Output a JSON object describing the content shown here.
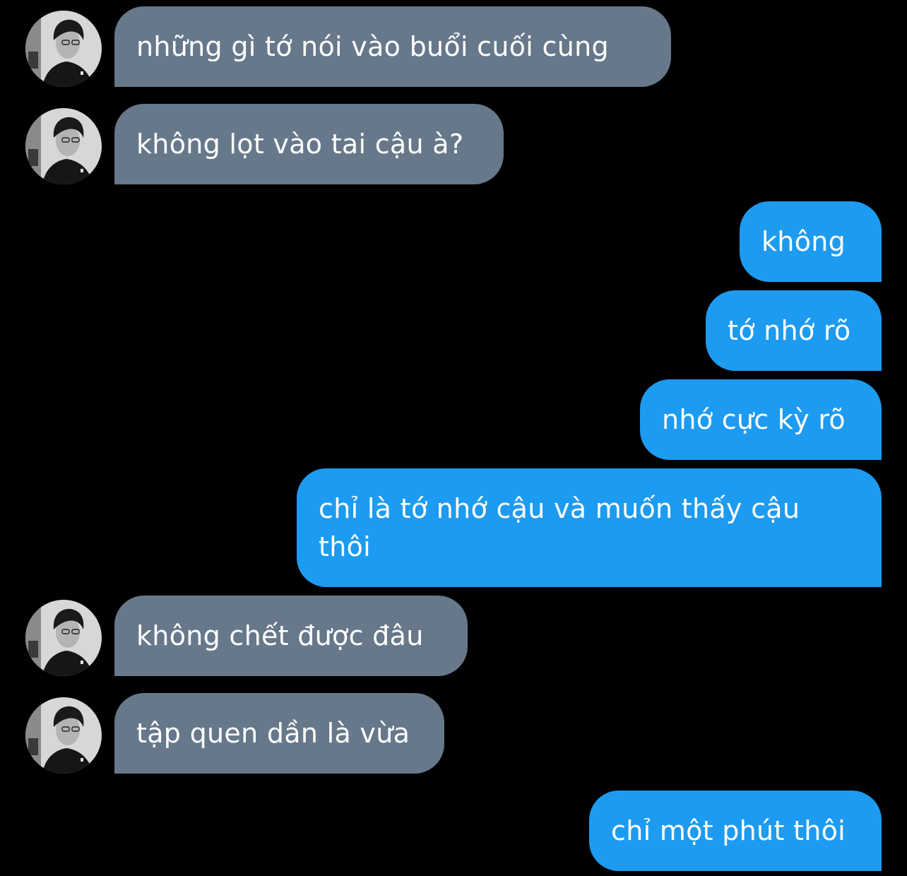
{
  "conversation": {
    "messages": [
      {
        "side": "received",
        "text": "những gì tớ nói vào buổi cuối cùng"
      },
      {
        "side": "received",
        "text": "không lọt vào tai cậu à?"
      },
      {
        "side": "sent",
        "text": "không"
      },
      {
        "side": "sent",
        "text": "tớ nhớ rõ"
      },
      {
        "side": "sent",
        "text": "nhớ cực kỳ rõ"
      },
      {
        "side": "sent",
        "text": "chỉ là tớ nhớ cậu và muốn thấy cậu thôi"
      },
      {
        "side": "received",
        "text": "không chết được đâu"
      },
      {
        "side": "received",
        "text": "tập quen dần là vừa"
      },
      {
        "side": "sent",
        "text": "chỉ một phút thôi"
      }
    ]
  },
  "colors": {
    "background": "#000000",
    "received_bubble": "#66788a",
    "sent_bubble": "#1d9bf0",
    "text": "#ffffff"
  },
  "icons": {
    "avatar": "contact-avatar-photo"
  }
}
